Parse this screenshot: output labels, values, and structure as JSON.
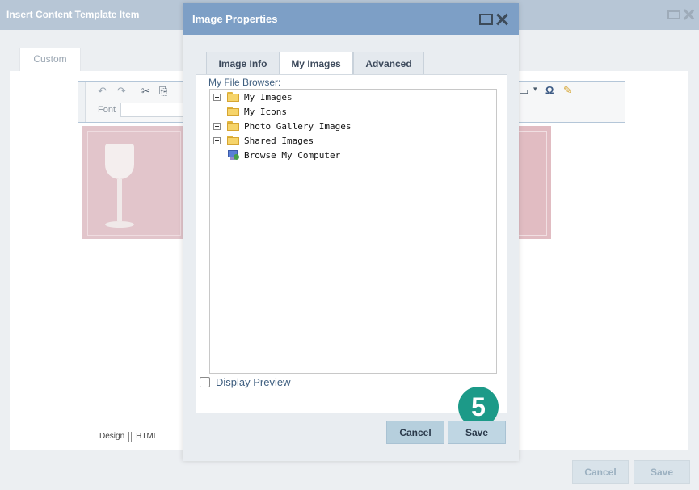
{
  "background": {
    "title": "Insert Content Template Item",
    "tab_label": "Custom",
    "editor": {
      "font_label": "Font",
      "bottom_tabs": [
        "Design",
        "HTML"
      ]
    },
    "buttons": {
      "cancel": "Cancel",
      "save": "Save"
    }
  },
  "dialog": {
    "title": "Image Properties",
    "tabs": [
      {
        "label": "Image Info",
        "active": false
      },
      {
        "label": "My Images",
        "active": true
      },
      {
        "label": "Advanced",
        "active": false
      }
    ],
    "file_browser_label": "My File Browser:",
    "tree": [
      {
        "label": "My Images",
        "expandable": true,
        "icon": "folder-icon"
      },
      {
        "label": "My Icons",
        "expandable": false,
        "icon": "folder-icon"
      },
      {
        "label": "Photo Gallery Images",
        "expandable": true,
        "icon": "folder-icon"
      },
      {
        "label": "Shared Images",
        "expandable": true,
        "icon": "folder-icon"
      },
      {
        "label": "Browse My Computer",
        "expandable": false,
        "icon": "computer-icon"
      }
    ],
    "display_preview_label": "Display Preview",
    "display_preview_checked": false,
    "step_badge": "5",
    "buttons": {
      "cancel": "Cancel",
      "save": "Save"
    }
  },
  "colors": {
    "dialog_titlebar": "#7d9fc6",
    "badge": "#1c9a88"
  }
}
